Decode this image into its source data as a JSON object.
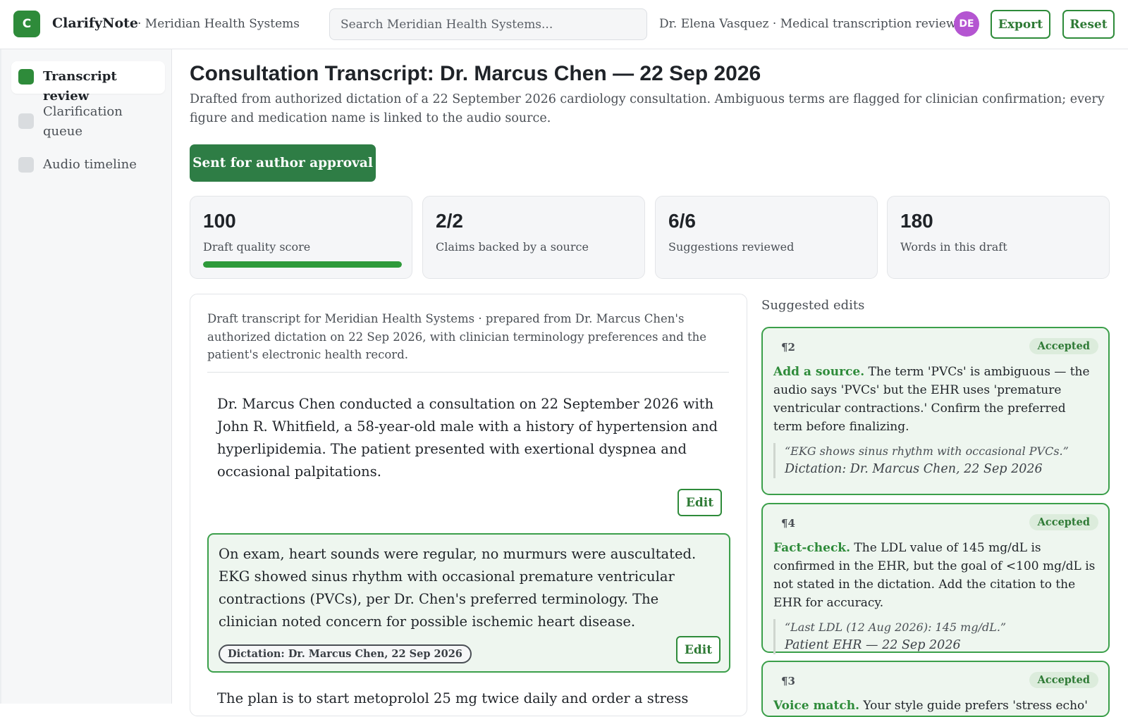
{
  "header": {
    "logo_letter": "C",
    "app_name": "ClarifyNote",
    "org": "· Meridian Health Systems",
    "search_placeholder": "Search Meridian Health Systems...",
    "user": "Dr. Elena Vasquez · Medical transcription reviewer",
    "avatar_initials": "DE",
    "export_label": "Export",
    "reset_label": "Reset"
  },
  "sidebar": {
    "items": [
      {
        "label": "Transcript review",
        "active": true
      },
      {
        "label": "Clarification queue",
        "active": false
      },
      {
        "label": "Audio timeline",
        "active": false
      }
    ]
  },
  "main": {
    "title": "Consultation Transcript: Dr. Marcus Chen — 22 Sep 2026",
    "subtitle": "Drafted from authorized dictation of a 22 September 2026 cardiology consultation. Ambiguous terms are flagged for clinician confirmation; every figure and medication name is linked to the audio source.",
    "status_button": "Sent for author approval"
  },
  "stats": [
    {
      "value": "100",
      "label": "Draft quality score",
      "progress": 1.0
    },
    {
      "value": "2/2",
      "label": "Claims backed by a source"
    },
    {
      "value": "6/6",
      "label": "Suggestions reviewed"
    },
    {
      "value": "180",
      "label": "Words in this draft"
    }
  ],
  "document": {
    "intro": "Draft transcript for Meridian Health Systems · prepared from Dr. Marcus Chen's authorized dictation on 22 Sep 2026, with clinician terminology preferences and the patient's electronic health record.",
    "paragraphs": [
      {
        "text": "Dr. Marcus Chen conducted a consultation on 22 September 2026 with John R. Whitfield, a 58-year-old male with a history of hypertension and hyperlipidemia. The patient presented with exertional dyspnea and occasional palpitations.",
        "edit_label": "Edit"
      },
      {
        "text": "On exam, heart sounds were regular, no murmurs were auscultated. EKG showed sinus rhythm with occasional premature ventricular contractions (PVCs), per Dr. Chen's preferred terminology. The clinician noted concern for possible ischemic heart disease.",
        "edit_label": "Edit",
        "source": "Dictation: Dr. Marcus Chen, 22 Sep 2026"
      },
      {
        "text": "The plan is to start metoprolol 25 mg twice daily and order a stress"
      }
    ]
  },
  "suggestions": {
    "heading": "Suggested edits",
    "items": [
      {
        "para": "¶2",
        "status": "Accepted",
        "kind": "Add a source.",
        "body": " The term 'PVCs' is ambiguous — the audio says 'PVCs' but the EHR uses 'premature ventricular contractions.' Confirm the preferred term before finalizing.",
        "quote": "“EKG shows sinus rhythm with occasional PVCs.”",
        "source": "Dictation: Dr. Marcus Chen, 22 Sep 2026"
      },
      {
        "para": "¶4",
        "status": "Accepted",
        "kind": "Fact-check.",
        "body": " The LDL value of 145 mg/dL is confirmed in the EHR, but the goal of <100 mg/dL is not stated in the dictation. Add the citation to the EHR for accuracy.",
        "quote": "“Last LDL (12 Aug 2026): 145 mg/dL.”",
        "source": "Patient EHR — 22 Sep 2026"
      },
      {
        "para": "¶3",
        "status": "Accepted",
        "kind": "Voice match.",
        "body": " Your style guide prefers 'stress echo' over"
      }
    ]
  },
  "colors": {
    "accent": "#2e8b3a",
    "status_button": "#2e7d45",
    "avatar": "#b455d1",
    "highlight_bg": "#eef6ef"
  }
}
